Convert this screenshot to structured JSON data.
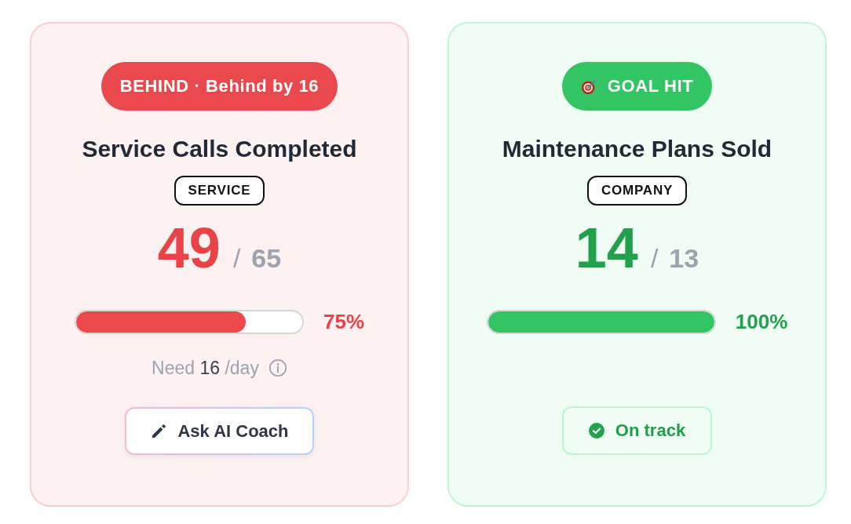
{
  "cards": [
    {
      "kind": "behind",
      "badge": {
        "label": "BEHIND · Behind by 16"
      },
      "title": "Service Calls Completed",
      "tag": "SERVICE",
      "value": "49",
      "separator": "/",
      "target": "65",
      "progress": {
        "level": 0.75,
        "reading": "75%"
      },
      "need": {
        "prefix": "Need",
        "amount": "16",
        "suffix": "/day"
      },
      "action": {
        "kind": "ai-coach",
        "label": "Ask AI Coach"
      }
    },
    {
      "kind": "goal-hit",
      "badge": {
        "label": "GOAL HIT"
      },
      "title": "Maintenance Plans Sold",
      "tag": "COMPANY",
      "value": "14",
      "separator": "/",
      "target": "13",
      "progress": {
        "level": 1,
        "reading": "100%"
      },
      "action": {
        "kind": "status",
        "label": "On track"
      }
    }
  ]
}
